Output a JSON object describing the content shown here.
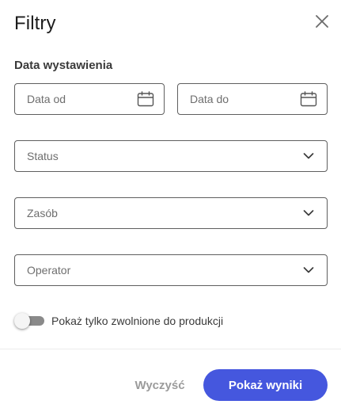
{
  "dialog": {
    "title": "Filtry",
    "close_icon": "close-icon"
  },
  "date_section": {
    "label": "Data wystawienia",
    "date_from_placeholder": "Data od",
    "date_to_placeholder": "Data do",
    "icon": "calendar-icon"
  },
  "selects": {
    "status_placeholder": "Status",
    "zasob_placeholder": "Zasób",
    "operator_placeholder": "Operator",
    "icon": "chevron-down-icon"
  },
  "toggle": {
    "label": "Pokaż tylko zwolnione do produkcji",
    "checked": false
  },
  "footer": {
    "clear_label": "Wyczyść",
    "submit_label": "Pokaż wyniki"
  },
  "colors": {
    "accent": "#4557de",
    "border": "#5f5f5f",
    "muted_text": "#9b9b9b"
  }
}
